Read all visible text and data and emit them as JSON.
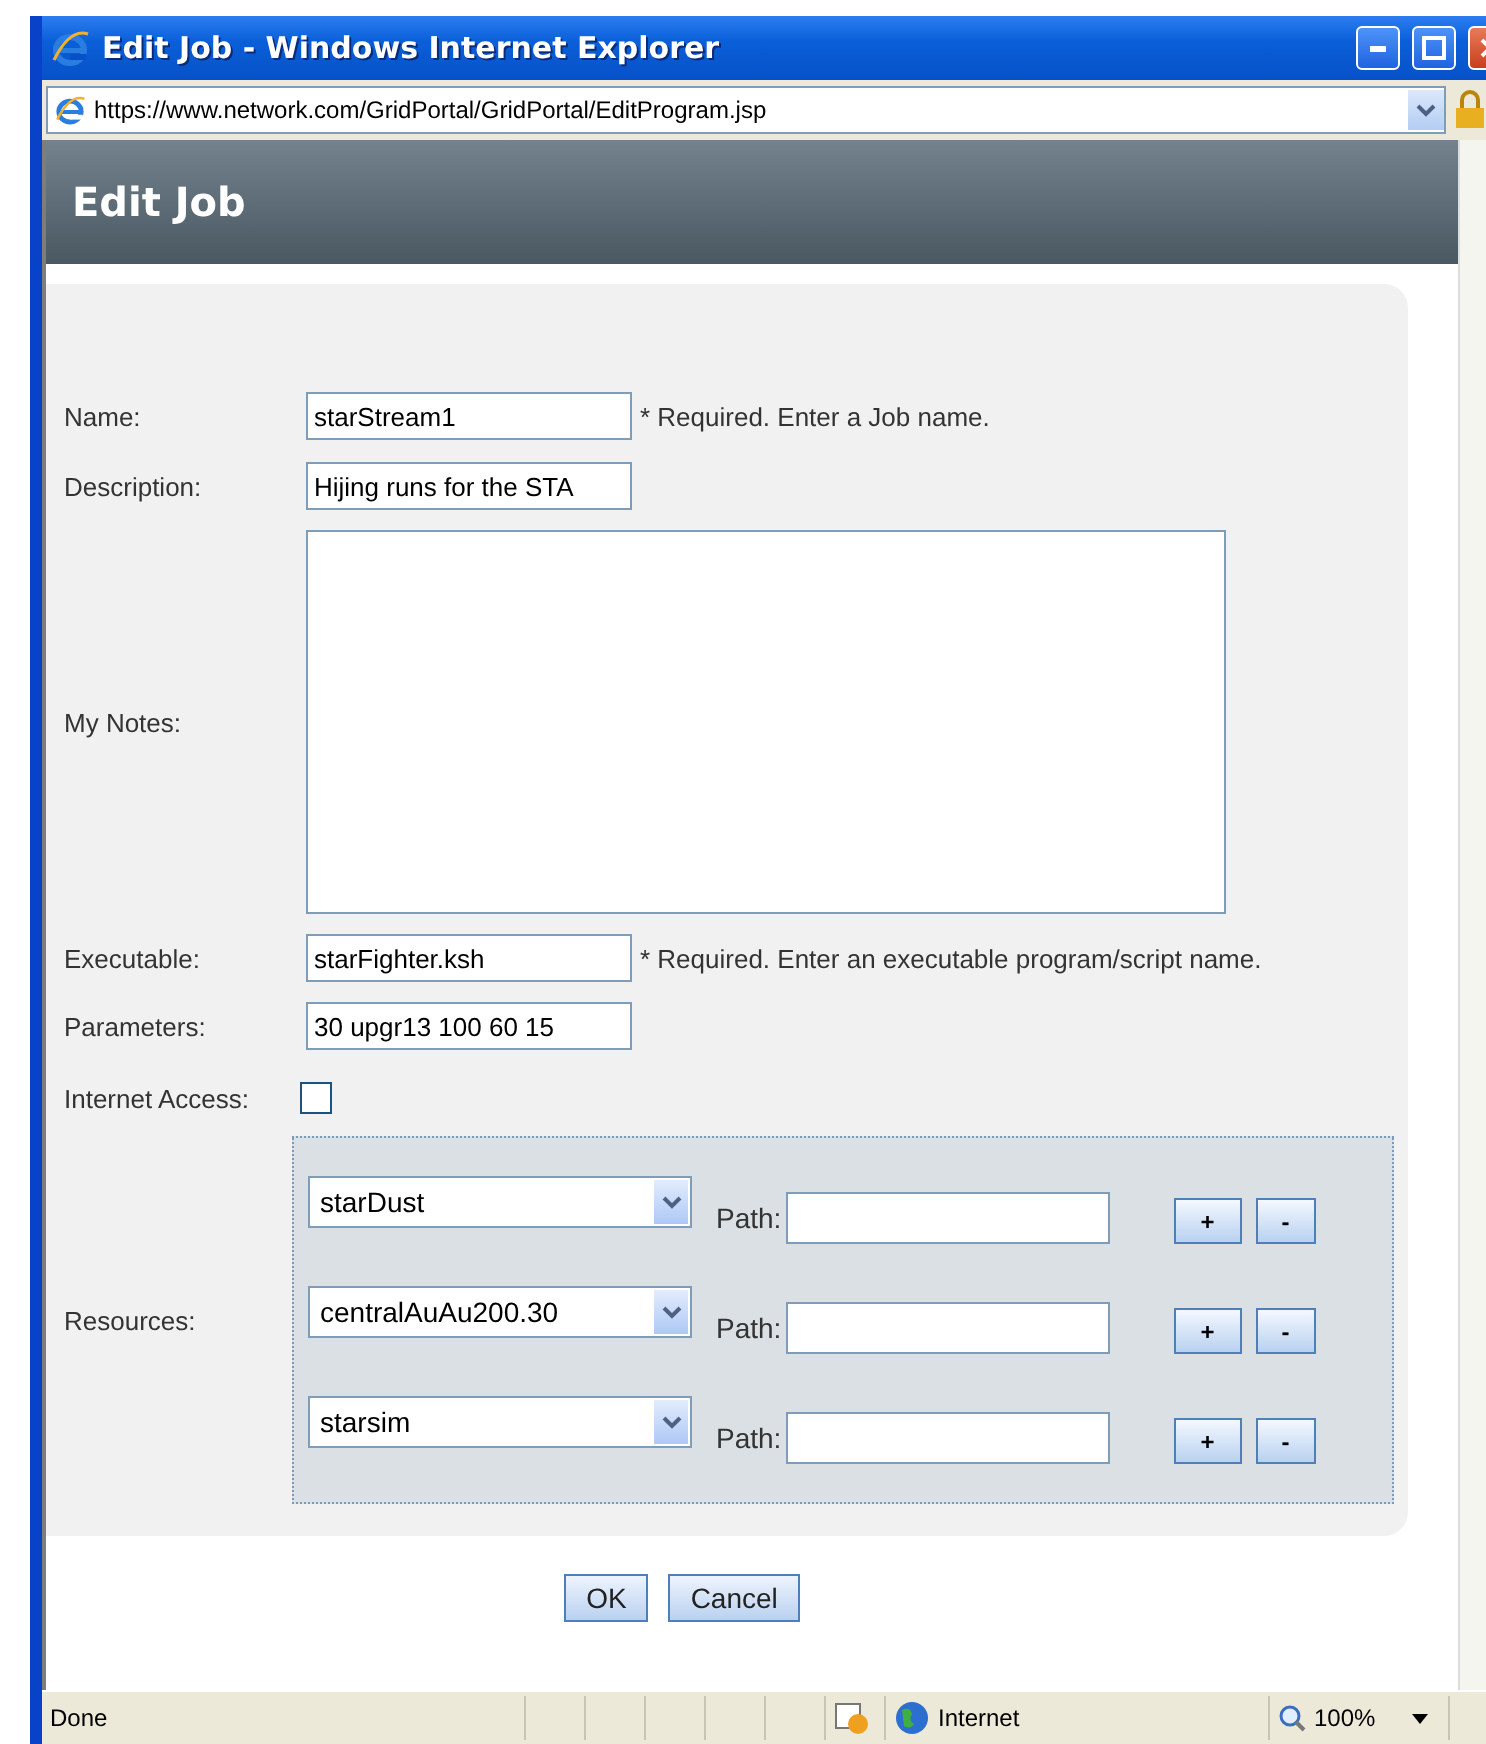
{
  "window": {
    "title": "Edit Job - Windows Internet Explorer",
    "address": "https://www.network.com/GridPortal/GridPortal/EditProgram.jsp"
  },
  "page": {
    "heading": "Edit Job"
  },
  "form": {
    "fields": [
      {
        "kind": "text",
        "label": "Name:",
        "value": "starStream1",
        "hint": "* Required. Enter a Job name."
      },
      {
        "kind": "text",
        "label": "Description:",
        "value": "Hijing runs for the STA"
      },
      {
        "kind": "textarea",
        "label": "My Notes:"
      },
      {
        "kind": "text",
        "label": "Executable:",
        "value": "starFighter.ksh",
        "hint": "* Required. Enter an executable program/script name."
      },
      {
        "kind": "text",
        "label": "Parameters:",
        "value": "30 upgr13 100 60 15"
      },
      {
        "kind": "checkbox",
        "label": "Internet Access:",
        "checked": false
      }
    ],
    "resources": {
      "label": "Resources:",
      "rows": [
        {
          "value": "starDust",
          "path_label": "Path:",
          "add": "+",
          "remove": "-"
        },
        {
          "value": "centralAuAu200.30",
          "path_label": "Path:",
          "add": "+",
          "remove": "-"
        },
        {
          "value": "starsim",
          "path_label": "Path:",
          "add": "+",
          "remove": "-"
        }
      ]
    }
  },
  "buttons": [
    "OK",
    "Cancel"
  ],
  "status_bar": {
    "text": "Done",
    "zone": "Internet",
    "zoom": "100%"
  }
}
